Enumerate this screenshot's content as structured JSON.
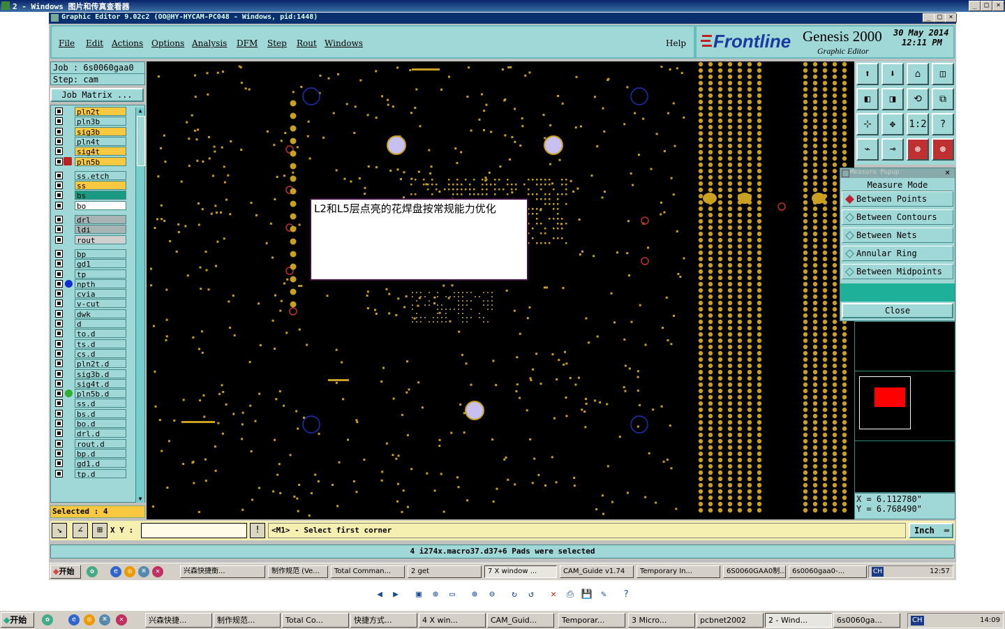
{
  "viewer": {
    "title": "2 - Windows 图片和传真查看器",
    "buttons": {
      "min": "_",
      "max": "□",
      "close": "×"
    }
  },
  "app": {
    "title": "Graphic Editor 9.02c2  (OO@HY-HYCAM-PC048 - Windows, pid:1448)",
    "menu": [
      "File",
      "Edit",
      "Actions",
      "Options",
      "Analysis",
      "DFM",
      "Step",
      "Rout",
      "Windows"
    ],
    "help": "Help",
    "brand": "Frontline",
    "product": "Genesis 2000",
    "product_sub": "Graphic Editor",
    "date": "30 May 2014",
    "time": "12:11 PM"
  },
  "job": {
    "job_label": "Job : 6s0060gaa0",
    "step_label": "Step: cam",
    "matrix_button": "Job Matrix ..."
  },
  "layers": [
    {
      "name": "pln2t",
      "color": "#f7c840"
    },
    {
      "name": "pln3b",
      "color": "#9fd8d6"
    },
    {
      "name": "sig3b",
      "color": "#f7c840"
    },
    {
      "name": "pln4t",
      "color": "#9fd8d6"
    },
    {
      "name": "sig4t",
      "color": "#f7c840"
    },
    {
      "name": "pln5b",
      "color": "#f7c840"
    },
    {
      "name": "ss.etch",
      "color": "#9fd8d6"
    },
    {
      "name": "ss",
      "color": "#f7c840"
    },
    {
      "name": "bs",
      "color": "#1a9a80"
    },
    {
      "name": "bo",
      "color": "#ffffff"
    },
    {
      "name": "drl",
      "color": "#a8b4b4"
    },
    {
      "name": "ldi",
      "color": "#a8b4b4"
    },
    {
      "name": "rout",
      "color": "#d0d0d0"
    },
    {
      "name": "bp",
      "color": "#9fd8d6"
    },
    {
      "name": "gd1",
      "color": "#9fd8d6"
    },
    {
      "name": "tp",
      "color": "#9fd8d6"
    },
    {
      "name": "npth",
      "color": "#9fd8d6"
    },
    {
      "name": "cvia",
      "color": "#9fd8d6"
    },
    {
      "name": "v-cut",
      "color": "#9fd8d6"
    },
    {
      "name": "dwk",
      "color": "#9fd8d6"
    },
    {
      "name": "d",
      "color": "#9fd8d6"
    },
    {
      "name": "to.d",
      "color": "#9fd8d6"
    },
    {
      "name": "ts.d",
      "color": "#9fd8d6"
    },
    {
      "name": "cs.d",
      "color": "#9fd8d6"
    },
    {
      "name": "pln2t.d",
      "color": "#9fd8d6"
    },
    {
      "name": "sig3b.d",
      "color": "#9fd8d6"
    },
    {
      "name": "sig4t.d",
      "color": "#9fd8d6"
    },
    {
      "name": "pln5b.d",
      "color": "#9fd8d6"
    },
    {
      "name": "ss.d",
      "color": "#9fd8d6"
    },
    {
      "name": "bs.d",
      "color": "#9fd8d6"
    },
    {
      "name": "bo.d",
      "color": "#9fd8d6"
    },
    {
      "name": "drl.d",
      "color": "#9fd8d6"
    },
    {
      "name": "rout.d",
      "color": "#9fd8d6"
    },
    {
      "name": "bp.d",
      "color": "#9fd8d6"
    },
    {
      "name": "gd1.d",
      "color": "#9fd8d6"
    },
    {
      "name": "tp.d",
      "color": "#9fd8d6"
    }
  ],
  "selected_label": "Selected : 4",
  "note_text": "L2和L5层点亮的花焊盘按常规能力优化",
  "toolbar_icons": [
    "layer-up-icon",
    "layer-down-icon",
    "home-icon",
    "split-view-icon",
    "panel-left-icon",
    "panel-right-icon",
    "mirror-icon",
    "snap-icon",
    "fit-all-icon",
    "zoom-fit-icon",
    "scale-1-2-icon",
    "help-icon",
    "edit-tool-icon",
    "probe-icon",
    "net-red-icon",
    "net-red-2-icon"
  ],
  "toolbar_texts": {
    "scale": "1:2",
    "help": "?"
  },
  "measure": {
    "title": "Measure Popup",
    "mode_label": "Measure Mode",
    "options": [
      "Between Points",
      "Between Contours",
      "Between Nets",
      "Annular Ring",
      "Between Midpoints"
    ],
    "close": "Close"
  },
  "coords": {
    "x": "X  =  6.112780\"",
    "y": "Y  =  6.768490\""
  },
  "command": {
    "xy_label": "X Y :",
    "prompt": "<M1> - Select first corner",
    "unit": "Inch"
  },
  "status_message": "4 i274x.macro37.d37+6 Pads were selected",
  "inner_taskbar": {
    "start": "开始",
    "tasks": [
      "兴森快捷衡...",
      "制作规范 (Ve...",
      "Total Comman...",
      "2 get",
      "7 X window ...",
      "CAM_Guide v1.74",
      "Temporary In...",
      "6S0060GAA0制...",
      "6s0060gaa0-..."
    ],
    "lang": "CH",
    "clock": "12:57"
  },
  "outer_taskbar": {
    "start": "开始",
    "tasks": [
      "兴森快捷...",
      "制作规范...",
      "Total Co...",
      "快捷方式...",
      "4 X win...",
      "CAM_Guid...",
      "Temporar...",
      "3 Micro...",
      "pcbnet2002",
      "2 - Wind...",
      "6s0060ga..."
    ],
    "lang": "CH",
    "clock": "14:09"
  },
  "viewer_toolbar_icons": [
    "previous-icon",
    "next-icon",
    "best-fit-icon",
    "actual-size-icon",
    "slideshow-icon",
    "zoom-in-icon",
    "zoom-out-icon",
    "rotate-cw-icon",
    "rotate-ccw-icon",
    "delete-icon",
    "print-icon",
    "save-icon",
    "edit-icon",
    "help-icon"
  ]
}
